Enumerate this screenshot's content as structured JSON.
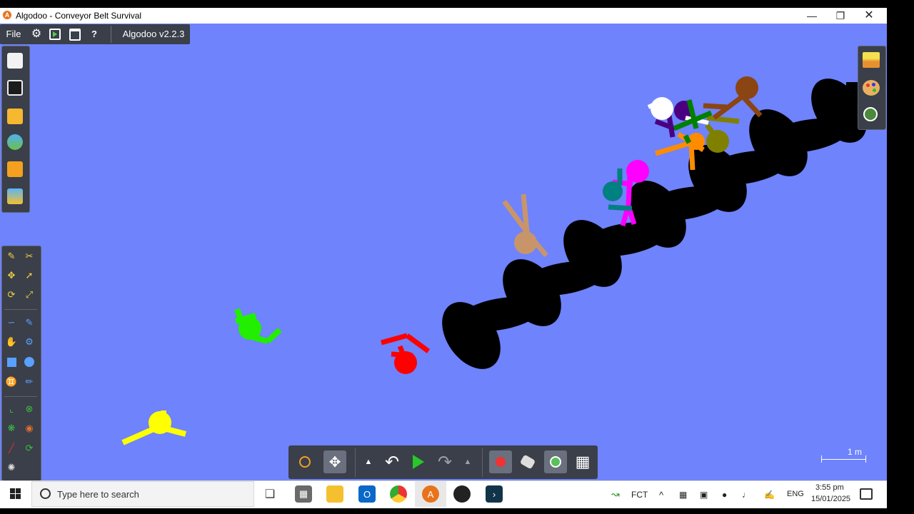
{
  "window": {
    "title": "Algodoo - Conveyor Belt Survival",
    "minimize_icon": "minimize-icon",
    "maximize_icon": "restore-icon",
    "close_icon": "close-icon"
  },
  "menu": {
    "file_label": "File",
    "version_label": "Algodoo v2.2.3",
    "icons": [
      "settings-gear-icon",
      "play-scene-icon",
      "window-icon",
      "help-icon"
    ]
  },
  "left_toolbar": {
    "icons": [
      "new-scene-icon",
      "print-icon",
      "open-folder-icon",
      "open-web-icon",
      "lessons-icon",
      "save-image-icon"
    ]
  },
  "tools": {
    "icons": [
      "sketch-tool-icon",
      "cut-tool-icon",
      "move-tool-icon",
      "drag-tool-icon",
      "rotate-tool-icon",
      "scale-tool-icon",
      "rope-tool-icon",
      "brush-tool-icon",
      "plane-tool-icon",
      "gear-tool-icon",
      "box-tool-icon",
      "circle-tool-icon",
      "fixate-tool-icon",
      "spring-tool-icon",
      "chain-tool-icon",
      "axle-tool-icon",
      "thruster-tool-icon",
      "tracer-tool-icon",
      "laser-tool-icon",
      "hinge-tool-icon",
      "water-tool-icon"
    ]
  },
  "right_panel": {
    "icons": [
      "background-icon",
      "palette-icon",
      "zoom-to-scene-icon"
    ]
  },
  "bottom_bar": {
    "icons": [
      "zoom-icon",
      "pan-icon",
      "undo-menu-icon",
      "undo-icon",
      "play-icon",
      "redo-icon",
      "redo-menu-icon",
      "gravity-icon",
      "air-friction-icon",
      "collision-icon",
      "grid-icon"
    ]
  },
  "scale": {
    "label": "1 m"
  },
  "taskbar": {
    "search_placeholder": "Type here to search",
    "apps": [
      "task-view-icon",
      "calculator-icon",
      "file-explorer-icon",
      "outlook-icon",
      "chrome-icon",
      "algodoo-icon",
      "obs-icon",
      "terminal-icon"
    ],
    "tray": {
      "weather": "FCT",
      "language": "ENG",
      "time": "3:55 pm",
      "date": "15/01/2025"
    }
  },
  "colors": {
    "canvas_bg": "#6e83fc",
    "toolbar_bg": "#3a3f4a",
    "ragdoll_colors": [
      "#ffff00",
      "#22ee00",
      "#ff0000",
      "#c8956b",
      "#ff00ff",
      "#008080",
      "#ffffff",
      "#4b0082",
      "#008000",
      "#ff8c00",
      "#808000",
      "#8b4513"
    ]
  }
}
